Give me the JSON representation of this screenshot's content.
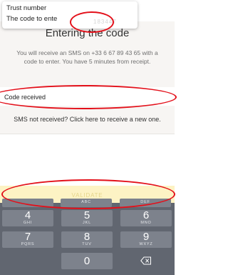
{
  "notification": {
    "title": "Trust number",
    "message": "The code to ente",
    "code": "183447"
  },
  "page": {
    "title": "Entering the code",
    "instructions": "You will receive an SMS on +33 6 67 89 43 65 with a code to enter. You have 5 minutes from receipt."
  },
  "code_input": {
    "value": "Code received"
  },
  "resend_link": "SMS not received? Click here to receive a new one.",
  "validate_button": "VALIDATE",
  "keypad": {
    "keys": [
      {
        "num": "4",
        "letters": "GHI"
      },
      {
        "num": "5",
        "letters": "JKL"
      },
      {
        "num": "6",
        "letters": "MNO"
      },
      {
        "num": "7",
        "letters": "PQRS"
      },
      {
        "num": "8",
        "letters": "TUV"
      },
      {
        "num": "9",
        "letters": "WXYZ"
      },
      {
        "num": "0",
        "letters": ""
      }
    ],
    "partial_row": [
      "ABC",
      "DEF"
    ],
    "backspace_icon": "backspace-icon"
  },
  "colors": {
    "highlight": "#e3101a",
    "validate_bg": "#fdf3c4",
    "keypad_bg": "#616670",
    "key_bg": "#7d828c"
  }
}
